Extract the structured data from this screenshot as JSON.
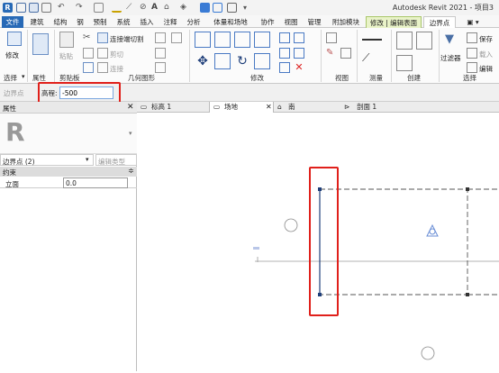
{
  "app": {
    "title": "Autodesk Revit 2021 - 项目3"
  },
  "ribbon_tabs": [
    {
      "label": "文件"
    },
    {
      "label": "建筑"
    },
    {
      "label": "结构"
    },
    {
      "label": "钢"
    },
    {
      "label": "预制"
    },
    {
      "label": "系统"
    },
    {
      "label": "插入"
    },
    {
      "label": "注释"
    },
    {
      "label": "分析"
    },
    {
      "label": "体量和场地"
    },
    {
      "label": "协作"
    },
    {
      "label": "视图"
    },
    {
      "label": "管理"
    },
    {
      "label": "附加模块"
    },
    {
      "label": "修改 | 编辑表面"
    },
    {
      "label": "边界点"
    }
  ],
  "ribbon": {
    "modify_label": "修改",
    "paste_label": "粘贴",
    "join_cut_label": "连接端切割",
    "cut_label": "剪切",
    "join_label": "连接",
    "filter_label": "过滤器",
    "save_label": "保存",
    "load_label": "载入",
    "edit_label": "编辑",
    "panels": [
      {
        "label": "选择"
      },
      {
        "label": "属性"
      },
      {
        "label": "剪贴板"
      },
      {
        "label": "几何图形"
      },
      {
        "label": "修改"
      },
      {
        "label": "视图"
      },
      {
        "label": "测量"
      },
      {
        "label": "创建"
      },
      {
        "label": "选择"
      }
    ]
  },
  "options_bar": {
    "context_label": "边界点",
    "elevation_label": "高程:",
    "elevation_value": "-500"
  },
  "properties": {
    "title": "属性",
    "type_selector": "边界点 (2)",
    "edit_type_label": "编辑类型",
    "group_label": "约束",
    "rows": [
      {
        "name": "立面",
        "value": "0.0"
      }
    ]
  },
  "view_tabs": [
    {
      "label": "标高 1"
    },
    {
      "label": "场地"
    },
    {
      "label": "南"
    },
    {
      "label": "剖面 1"
    }
  ],
  "colors": {
    "file_tab": "#2769b6",
    "contextual_tab": "#e9f3c8",
    "highlight": "#e0201b",
    "selection": "#1f3f7a"
  }
}
